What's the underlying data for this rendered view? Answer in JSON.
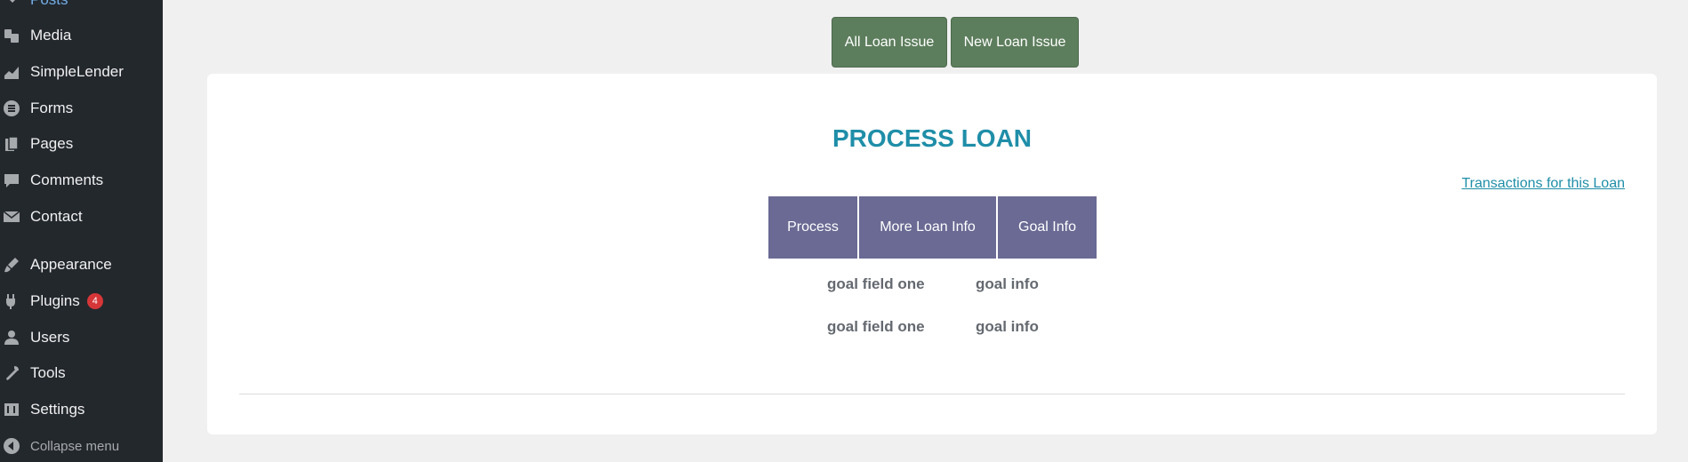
{
  "sidebar": {
    "items": [
      {
        "label": "Posts",
        "icon": "pin-icon"
      },
      {
        "label": "Media",
        "icon": "media-icon"
      },
      {
        "label": "SimpleLender",
        "icon": "chart-icon"
      },
      {
        "label": "Forms",
        "icon": "forms-icon"
      },
      {
        "label": "Pages",
        "icon": "pages-icon"
      },
      {
        "label": "Comments",
        "icon": "comment-icon"
      },
      {
        "label": "Contact",
        "icon": "envelope-icon"
      },
      {
        "label": "Appearance",
        "icon": "brush-icon"
      },
      {
        "label": "Plugins",
        "icon": "plugin-icon",
        "badge": "4"
      },
      {
        "label": "Users",
        "icon": "user-icon"
      },
      {
        "label": "Tools",
        "icon": "wrench-icon"
      },
      {
        "label": "Settings",
        "icon": "settings-icon"
      }
    ],
    "collapse_label": "Collapse menu"
  },
  "top_buttons": {
    "all_loan_issue": "All Loan Issue",
    "new_loan_issue": "New Loan Issue"
  },
  "card": {
    "title": "PROCESS LOAN",
    "transactions_link": "Transactions for this Loan",
    "tabs": [
      "Process",
      "More Loan Info",
      "Goal Info"
    ],
    "goal_rows": [
      {
        "field": "goal field one",
        "value": "goal info"
      },
      {
        "field": "goal field one",
        "value": "goal info"
      }
    ]
  },
  "colors": {
    "sidebar_bg": "#23282d",
    "button_green": "#5d7e5d",
    "tab_purple": "#6a6a94",
    "title_teal": "#1f8ea8",
    "badge_red": "#d63638"
  }
}
